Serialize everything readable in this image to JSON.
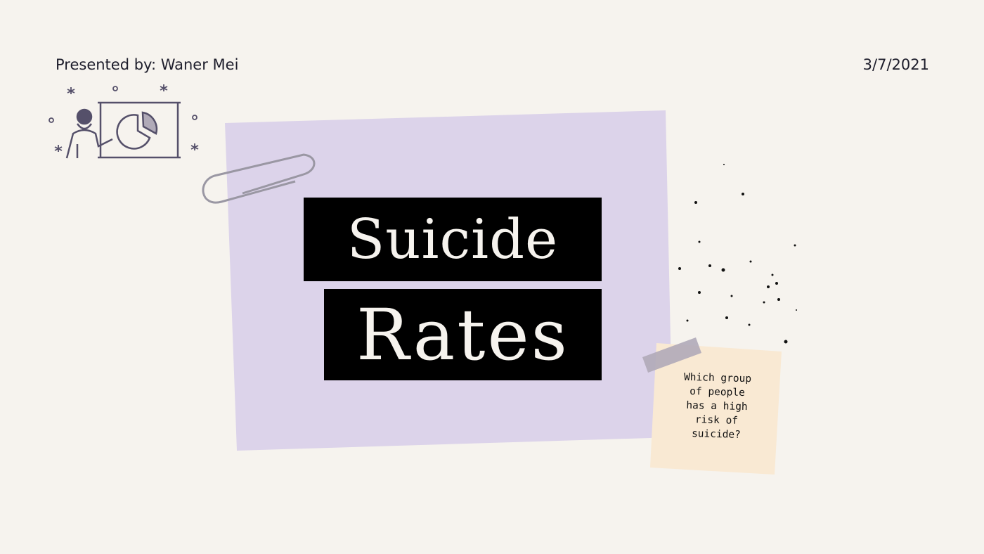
{
  "slide": {
    "presenter": "Presented by: Waner Mei",
    "date": "3/7/2021",
    "title_line1": "Suicide",
    "title_line2": "Rates",
    "note_lines": [
      "Which group",
      "of people",
      "has a high",
      "risk of",
      "suicide?"
    ]
  },
  "colors": {
    "background": "#f6f3ee",
    "paper": "#dcd3ea",
    "sticky_note": "#f9e9d3",
    "title_box": "#000000",
    "illustration": "#55506a"
  },
  "icons": [
    "presenter-illustration-icon",
    "pie-chart-icon",
    "paperclip-icon",
    "tape-icon"
  ]
}
